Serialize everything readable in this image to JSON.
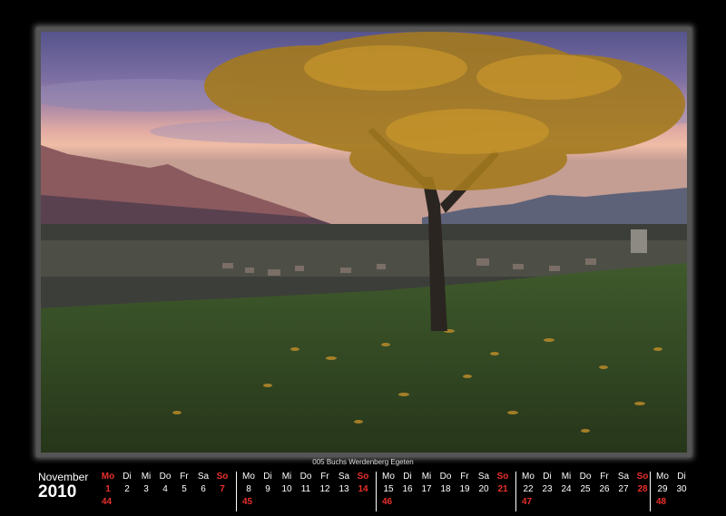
{
  "photo": {
    "subject": "autumn-tree-landscape"
  },
  "caption": "005 Buchs Werdenberg Egeten",
  "calendar": {
    "month": "November",
    "year": "2010",
    "weeks": [
      {
        "number": "44",
        "days": [
          {
            "name": "Mo",
            "date": "1",
            "holiday": true
          },
          {
            "name": "Di",
            "date": "2"
          },
          {
            "name": "Mi",
            "date": "3"
          },
          {
            "name": "Do",
            "date": "4"
          },
          {
            "name": "Fr",
            "date": "5"
          },
          {
            "name": "Sa",
            "date": "6"
          },
          {
            "name": "So",
            "date": "7",
            "holiday": true
          }
        ]
      },
      {
        "number": "45",
        "days": [
          {
            "name": "Mo",
            "date": "8"
          },
          {
            "name": "Di",
            "date": "9"
          },
          {
            "name": "Mi",
            "date": "10"
          },
          {
            "name": "Do",
            "date": "11"
          },
          {
            "name": "Fr",
            "date": "12"
          },
          {
            "name": "Sa",
            "date": "13"
          },
          {
            "name": "So",
            "date": "14",
            "holiday": true
          }
        ]
      },
      {
        "number": "46",
        "days": [
          {
            "name": "Mo",
            "date": "15"
          },
          {
            "name": "Di",
            "date": "16"
          },
          {
            "name": "Mi",
            "date": "17"
          },
          {
            "name": "Do",
            "date": "18"
          },
          {
            "name": "Fr",
            "date": "19"
          },
          {
            "name": "Sa",
            "date": "20"
          },
          {
            "name": "So",
            "date": "21",
            "holiday": true
          }
        ]
      },
      {
        "number": "47",
        "days": [
          {
            "name": "Mo",
            "date": "22"
          },
          {
            "name": "Di",
            "date": "23"
          },
          {
            "name": "Mi",
            "date": "24"
          },
          {
            "name": "Do",
            "date": "25"
          },
          {
            "name": "Fr",
            "date": "26"
          },
          {
            "name": "Sa",
            "date": "27"
          },
          {
            "name": "So",
            "date": "28",
            "holiday": true
          }
        ]
      },
      {
        "number": "48",
        "days": [
          {
            "name": "Mo",
            "date": "29"
          },
          {
            "name": "Di",
            "date": "30"
          }
        ]
      }
    ]
  },
  "colors": {
    "background": "#000000",
    "holiday": "#e8302a",
    "text": "#ffffff"
  }
}
